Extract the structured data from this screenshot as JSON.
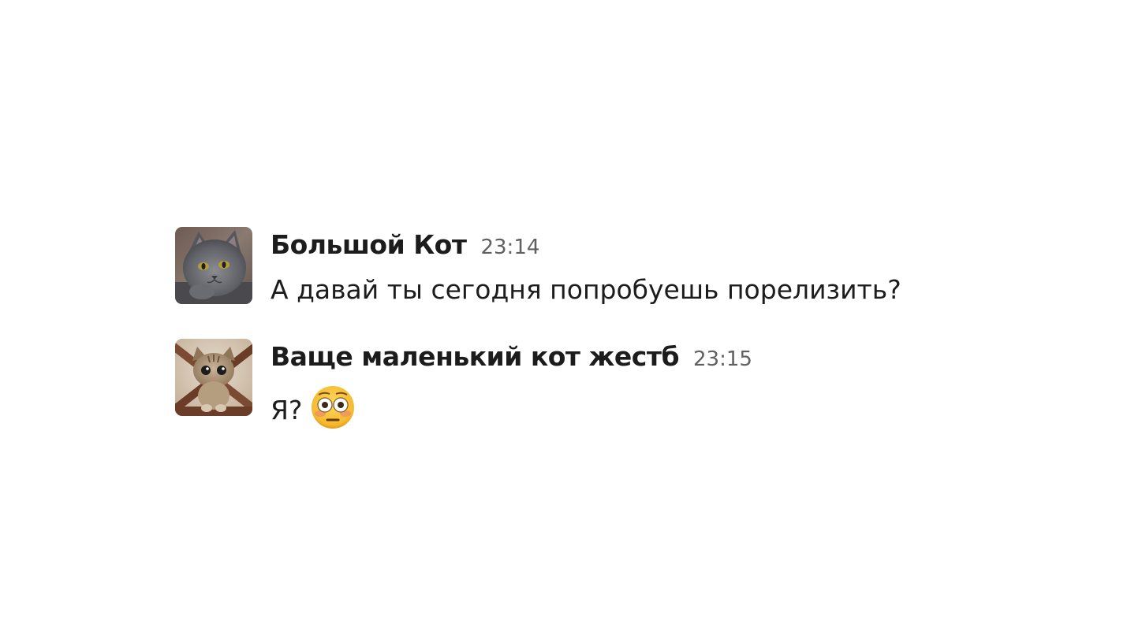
{
  "messages": [
    {
      "author": "Большой Кот",
      "time": "23:14",
      "text": "А давай ты сегодня попробуешь порелизить?",
      "avatar_icon": "gray-cat-avatar"
    },
    {
      "author": "Ваще маленький кот жестб",
      "time": "23:15",
      "text": "Я?",
      "emoji_icon": "flushed-face-emoji",
      "avatar_icon": "kitten-avatar"
    }
  ]
}
